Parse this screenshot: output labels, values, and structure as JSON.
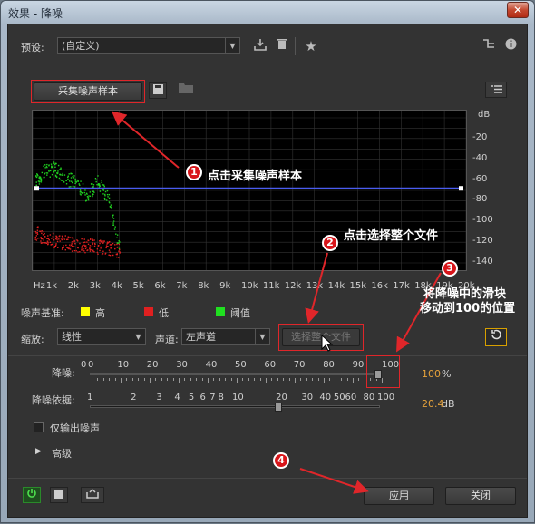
{
  "window": {
    "title": "效果 - 降噪",
    "close": "✕"
  },
  "header": {
    "preset_label": "预设:",
    "preset_value": "(自定义)"
  },
  "capture": {
    "button": "采集噪声样本"
  },
  "chart_data": {
    "type": "scatter",
    "x_ticks": [
      "Hz",
      "1k",
      "2k",
      "3k",
      "4k",
      "5k",
      "6k",
      "7k",
      "8k",
      "9k",
      "10k",
      "11k",
      "12k",
      "13k",
      "14k",
      "15k",
      "16k",
      "17k",
      "18k",
      "19k",
      "20k"
    ],
    "y_label": "dB",
    "y_ticks": [
      "-20",
      "-40",
      "-60",
      "-80",
      "-100",
      "-120",
      "-140"
    ],
    "ylim": [
      -140,
      0
    ],
    "threshold_line_db": -68,
    "legend": [
      {
        "name": "高",
        "color": "#ffff00"
      },
      {
        "name": "低",
        "color": "#e02020"
      },
      {
        "name": "阈值",
        "color": "#20e020"
      }
    ],
    "series": [
      {
        "name": "阈值",
        "color": "#20d020",
        "x_khz": [
          0.1,
          0.5,
          1,
          1.5,
          2,
          2.5,
          3,
          3.5,
          4
        ],
        "y_db": [
          -62,
          -52,
          -48,
          -58,
          -62,
          -75,
          -60,
          -80,
          -125
        ]
      },
      {
        "name": "低",
        "color": "#e02020",
        "x_khz": [
          0.1,
          0.5,
          1,
          1.5,
          2,
          2.5,
          3,
          3.5,
          4
        ],
        "y_db": [
          -110,
          -115,
          -118,
          -120,
          -122,
          -123,
          -124,
          -125,
          -128
        ]
      }
    ]
  },
  "legend_area": {
    "title": "噪声基准:",
    "high": "高",
    "low": "低",
    "threshold": "阈值"
  },
  "controls": {
    "zoom_label": "缩放:",
    "zoom_value": "线性",
    "channel_label": "声道:",
    "channel_value": "左声道",
    "select_file": "选择整个文件"
  },
  "reduction": {
    "label": "降噪:",
    "ticks": [
      "0",
      "0",
      "10",
      "20",
      "30",
      "40",
      "50",
      "60",
      "70",
      "80",
      "90",
      "100"
    ],
    "value": "100",
    "unit": "%",
    "level": 100
  },
  "reduce_by": {
    "label": "降噪依据:",
    "ticks": [
      "1",
      "2",
      "3",
      "4",
      "5",
      "6",
      "7",
      "8",
      "10",
      "20",
      "30",
      "40",
      "50",
      "60",
      "80",
      "100"
    ],
    "value": "20.4",
    "unit": "dB"
  },
  "output_noise": {
    "label": "仅输出噪声"
  },
  "advanced": {
    "label": "高级"
  },
  "footer": {
    "apply": "应用",
    "close": "关闭"
  },
  "annotations": {
    "n1": "1",
    "t1": "点击采集噪声样本",
    "n2": "2",
    "t2": "点击选择整个文件",
    "n3": "3",
    "t3a": "将降噪中的滑块",
    "t3b": "移动到100的位置",
    "n4": "4"
  }
}
